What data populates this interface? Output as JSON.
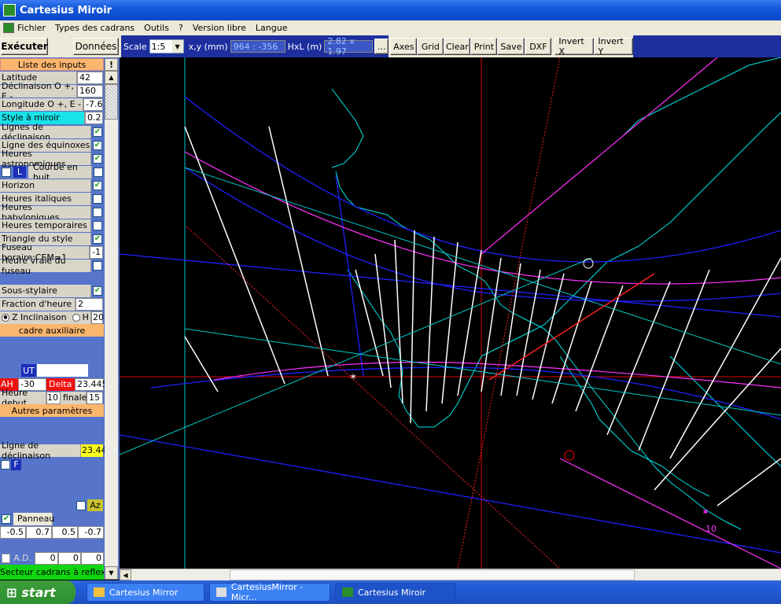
{
  "window": {
    "title": "Cartesius Miroir"
  },
  "menu": [
    "Fichier",
    "Types des cadrans",
    "Outils",
    "?",
    "Version libre",
    "Langue"
  ],
  "toolbar": {
    "execute": "Exécuter",
    "data": "Données",
    "scale_label": "Scale",
    "scale_value": "1:5",
    "xy_label": "x,y (mm)",
    "xy_value": "964 : -356",
    "hxl_label": "HxL (m)",
    "hxl_value": "2.82 x 1.97",
    "dots": "...",
    "buttons": [
      "Axes",
      "Grid",
      "Clear",
      "Print",
      "Save",
      "DXF",
      "Invert X",
      "Invert Y"
    ]
  },
  "panel": {
    "inputs_header": "Liste des inputs",
    "bang": "!",
    "latitude": {
      "label": "Latitude",
      "value": "42"
    },
    "declinaison": {
      "label": "Déclinaison O +, E -",
      "value": "160"
    },
    "longitude": {
      "label": "Longitude O +, E -",
      "value": "-7.6"
    },
    "style": {
      "label": "Style à miroir",
      "value": "0.2"
    },
    "options": [
      {
        "label": "Lignes de déclinaison",
        "checked": true
      },
      {
        "label": "Ligne des équinoxes",
        "checked": true
      },
      {
        "label": "Heures astronomiques",
        "checked": true
      },
      {
        "label": "Courbe en huit",
        "checked": false
      },
      {
        "label": "Horizon",
        "checked": true
      },
      {
        "label": "Heures italiques",
        "checked": false
      },
      {
        "label": "Heures babyloniques",
        "checked": false
      },
      {
        "label": "Heures temporaires",
        "checked": false
      },
      {
        "label": "Triangle du style",
        "checked": true
      },
      {
        "label": "Fuseau horaire:CEM=1",
        "value": "-1"
      },
      {
        "label": "Heure vraie du fuseau",
        "checked": false
      }
    ],
    "l_button": "L",
    "sous_stylaire": "Sous-stylaire",
    "fraction": {
      "label": "Fraction d'heure",
      "value": "2"
    },
    "z_inclinaison": "Z Inclinaison",
    "h_label": "H",
    "h_value": "20",
    "cadre": "cadre auxiliaire",
    "ut": "UT",
    "ah_label": "AH",
    "ah_value": "-30",
    "delta_label": "Delta",
    "delta_value": "23.445",
    "heure_debut": "Heure debut",
    "debut_value": "10",
    "finale": "finale",
    "finale_value": "15",
    "autres": "Autres paramètres",
    "ligne_decl": {
      "label": "Ligne de déclinaison",
      "value": "23.44"
    },
    "f_label": "F",
    "az_label": "Az",
    "panneau": "Panneau",
    "panneau_values": [
      "-0.5",
      "0.7",
      "0.5",
      "-0.7"
    ],
    "ad_label": "A.D.",
    "ad_values": [
      "0",
      "0",
      "0"
    ],
    "secteur": "Secteur cadrans à reflexion"
  },
  "canvas": {
    "mark_label": "10"
  },
  "taskbar": {
    "start": "start",
    "tasks": [
      "Cartesius Mirror",
      "CartesiusMirror - Micr...",
      "Cartesius Miroir"
    ]
  },
  "colors": {
    "accent_blue": "#0a47c8",
    "cyan": "#00ffff",
    "magenta": "#ff00ff",
    "red": "#ff0000",
    "panel_bg": "#5674c9",
    "orange": "#fbb66e"
  }
}
